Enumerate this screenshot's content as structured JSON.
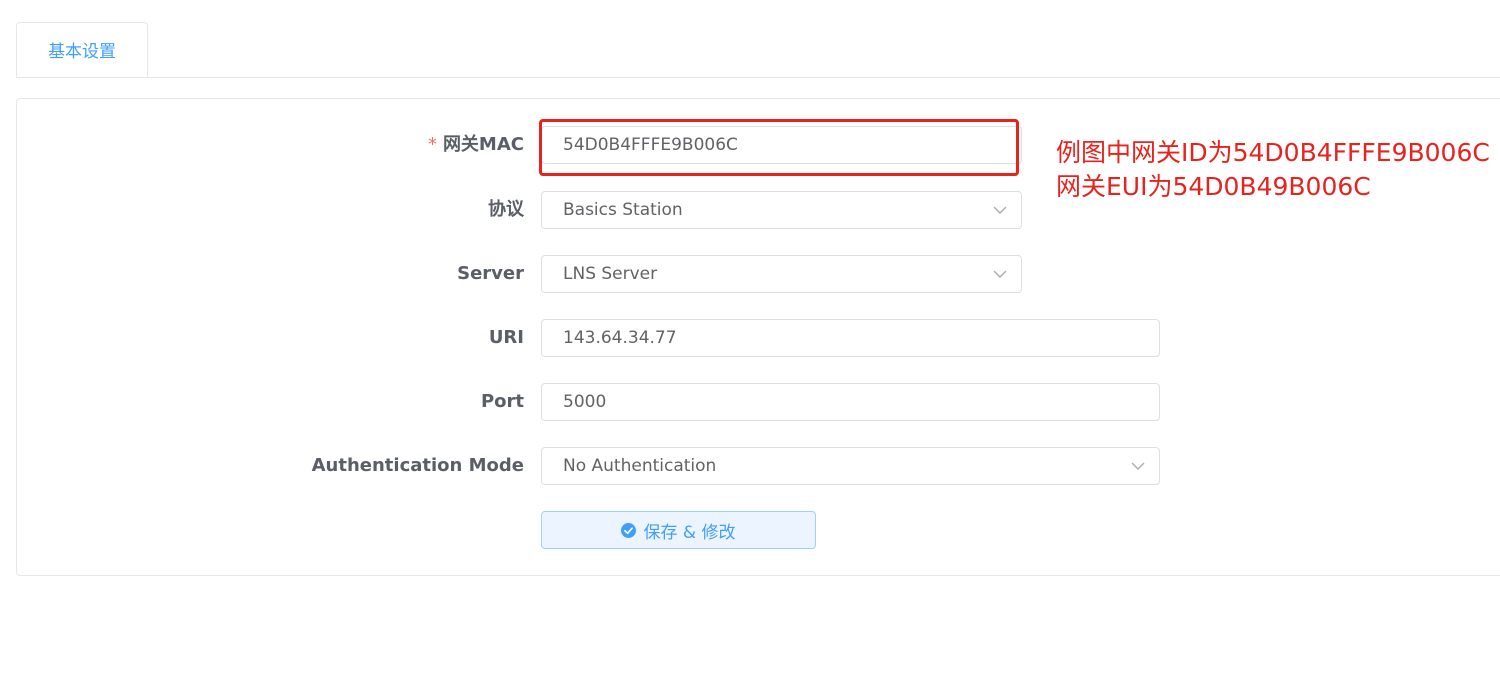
{
  "tabs": [
    {
      "label": "基本设置",
      "active": true
    }
  ],
  "form": {
    "required_mark": "*",
    "gateway_mac": {
      "label": "网关MAC",
      "value": "54D0B4FFFE9B006C"
    },
    "protocol": {
      "label": "协议",
      "value": "Basics Station"
    },
    "server": {
      "label": "Server",
      "value": "LNS Server"
    },
    "uri": {
      "label": "URI",
      "value": "143.64.34.77"
    },
    "port": {
      "label": "Port",
      "value": "5000"
    },
    "auth_mode": {
      "label": "Authentication Mode",
      "value": "No Authentication"
    },
    "save_label": "保存 & 修改"
  },
  "annotation": {
    "line1": "例图中网关ID为54D0B4FFFE9B006C",
    "line2": "网关EUI为54D0B49B006C"
  },
  "colors": {
    "accent": "#409eff",
    "required": "#f56c6c",
    "annotation": "#e8221d"
  },
  "icons": {
    "dropdown": "chevron-down-icon",
    "save": "check-circle-icon"
  }
}
